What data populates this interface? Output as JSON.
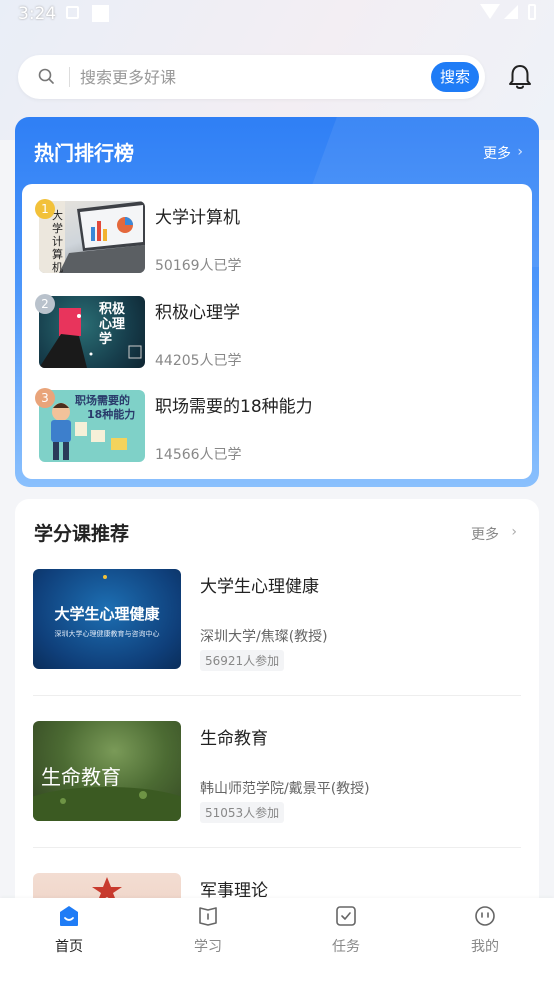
{
  "status_bar": {
    "time": "3:24"
  },
  "search": {
    "placeholder": "搜索更多好课",
    "button_label": "搜索"
  },
  "hot_ranking": {
    "title": "热门排行榜",
    "more_label": "更多",
    "items": [
      {
        "rank": "1",
        "name": "大学计算机",
        "learners": "50169人已学",
        "rank_color": "#f2c13a"
      },
      {
        "rank": "2",
        "name": "积极心理学",
        "learners": "44205人已学",
        "rank_color": "#b9c2cc"
      },
      {
        "rank": "3",
        "name": "职场需要的18种能力",
        "learners": "14566人已学",
        "rank_color": "#e9a47a"
      }
    ],
    "thumb_texts": {
      "computer": "大学计算机",
      "psych": "积极心理学",
      "career_line1": "职场需要的",
      "career_line2": "18种能力"
    }
  },
  "credit_courses": {
    "title": "学分课推荐",
    "more_label": "更多",
    "items": [
      {
        "name": "大学生心理健康",
        "school": "深圳大学/焦璨(教授)",
        "participants": "56921人参加",
        "thumb_title": "大学生心理健康",
        "thumb_subtitle": "深圳大学心理健康教育与咨询中心"
      },
      {
        "name": "生命教育",
        "school": "韩山师范学院/戴景平(教授)",
        "participants": "51053人参加",
        "thumb_title": "生命教育"
      },
      {
        "name": "军事理论"
      }
    ]
  },
  "tab_bar": {
    "tabs": [
      {
        "label": "首页",
        "active": true
      },
      {
        "label": "学习"
      },
      {
        "label": "任务"
      },
      {
        "label": "我的"
      }
    ]
  },
  "colors": {
    "accent": "#1f7cf6"
  }
}
